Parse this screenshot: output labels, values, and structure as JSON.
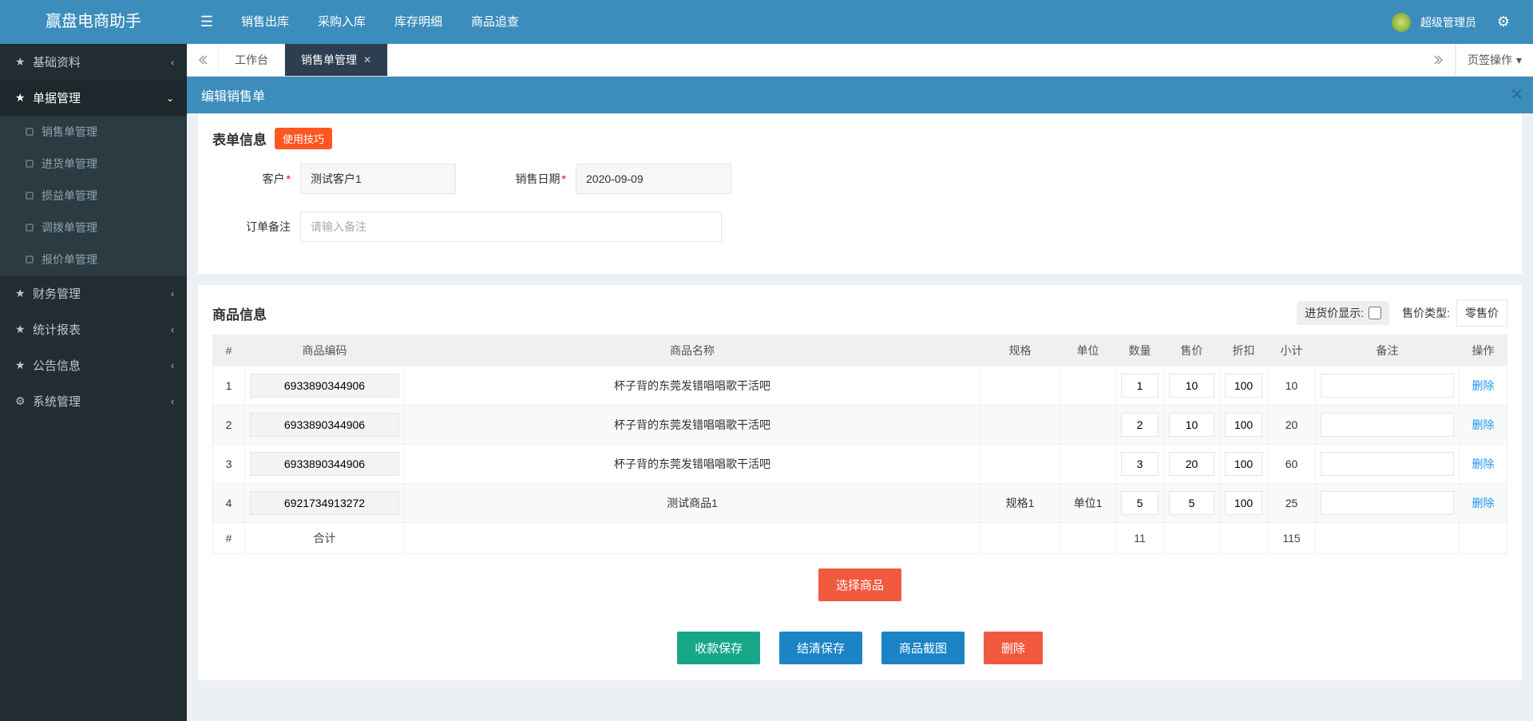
{
  "brand": "赢盘电商助手",
  "top_menu": [
    "销售出库",
    "采购入库",
    "库存明细",
    "商品追查"
  ],
  "user_name": "超级管理员",
  "sidebar": [
    {
      "label": "基础资料",
      "icon": "★",
      "expanded": false
    },
    {
      "label": "单据管理",
      "icon": "★",
      "expanded": true,
      "children": [
        "销售单管理",
        "进货单管理",
        "损益单管理",
        "调拨单管理",
        "报价单管理"
      ]
    },
    {
      "label": "财务管理",
      "icon": "★",
      "expanded": false
    },
    {
      "label": "统计报表",
      "icon": "★",
      "expanded": false
    },
    {
      "label": "公告信息",
      "icon": "★",
      "expanded": false
    },
    {
      "label": "系统管理",
      "icon": "⚙",
      "expanded": false
    }
  ],
  "tabs": {
    "items": [
      {
        "label": "工作台",
        "closable": false,
        "active": false
      },
      {
        "label": "销售单管理",
        "closable": true,
        "active": true
      }
    ],
    "ops_label": "页签操作"
  },
  "panel": {
    "title": "编辑销售单"
  },
  "form_section": {
    "title": "表单信息",
    "tip": "使用技巧",
    "customer_label": "客户",
    "customer_value": "测试客户1",
    "date_label": "销售日期",
    "date_value": "2020-09-09",
    "remark_label": "订单备注",
    "remark_placeholder": "请输入备注",
    "remark_value": ""
  },
  "goods_section": {
    "title": "商品信息",
    "inprice_label": "进货价显示:",
    "pricetype_label": "售价类型:",
    "pricetype_value": "零售价",
    "columns": [
      "#",
      "商品编码",
      "商品名称",
      "规格",
      "单位",
      "数量",
      "售价",
      "折扣",
      "小计",
      "备注",
      "操作"
    ],
    "rows": [
      {
        "idx": "1",
        "code": "6933890344906",
        "name": "杯子背的东莞发错唱唱歌干活吧",
        "spec": "",
        "unit": "",
        "qty": "1",
        "price": "10",
        "disc": "100",
        "sub": "10",
        "remark": ""
      },
      {
        "idx": "2",
        "code": "6933890344906",
        "name": "杯子背的东莞发错唱唱歌干活吧",
        "spec": "",
        "unit": "",
        "qty": "2",
        "price": "10",
        "disc": "100",
        "sub": "20",
        "remark": ""
      },
      {
        "idx": "3",
        "code": "6933890344906",
        "name": "杯子背的东莞发错唱唱歌干活吧",
        "spec": "",
        "unit": "",
        "qty": "3",
        "price": "20",
        "disc": "100",
        "sub": "60",
        "remark": ""
      },
      {
        "idx": "4",
        "code": "6921734913272",
        "name": "测试商品1",
        "spec": "规格1",
        "unit": "单位1",
        "qty": "5",
        "price": "5",
        "disc": "100",
        "sub": "25",
        "remark": ""
      }
    ],
    "total_row": {
      "idx": "#",
      "label": "合计",
      "qty": "11",
      "sub": "115"
    },
    "delete_label": "删除",
    "select_goods": "选择商品"
  },
  "actions": {
    "save_pay": "收款保存",
    "save_settle": "结清保存",
    "screenshot": "商品截图",
    "delete": "删除"
  }
}
